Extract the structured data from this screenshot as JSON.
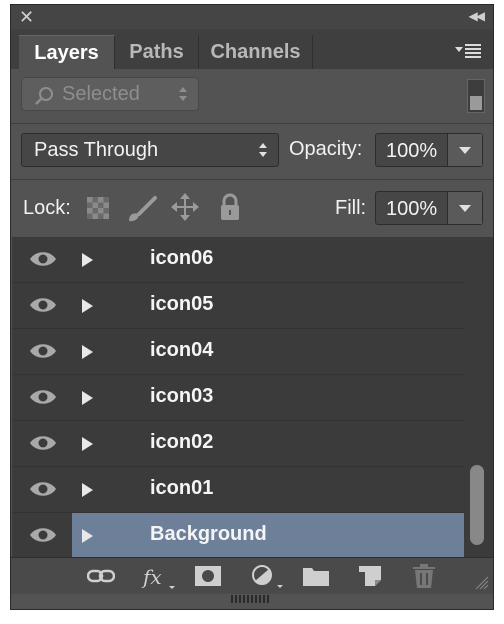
{
  "tabs": [
    "Layers",
    "Paths",
    "Channels"
  ],
  "filter": {
    "label": "Selected"
  },
  "blend": {
    "mode": "Pass Through",
    "opacity_label": "Opacity:",
    "opacity_value": "100%"
  },
  "lock": {
    "label": "Lock:"
  },
  "fill": {
    "label": "Fill:",
    "value": "100%"
  },
  "layers": [
    "icon06",
    "icon05",
    "icon04",
    "icon03",
    "icon02",
    "icon01",
    "Background"
  ],
  "selected_layer": "Background",
  "colors": {
    "panel": "#535353",
    "list": "#3b3b3b",
    "selected": "#6e7f9a"
  },
  "footer_icons": [
    "link-icon",
    "fx-icon",
    "mask-icon",
    "adjustment-icon",
    "folder-icon",
    "new-layer-icon",
    "trash-icon"
  ]
}
